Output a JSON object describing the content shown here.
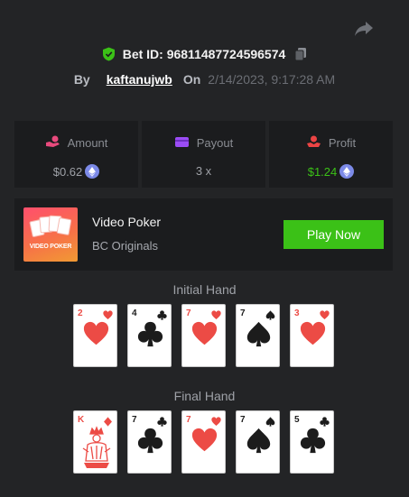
{
  "bet": {
    "id_label": "Bet ID: 96811487724596574",
    "by_label": "By",
    "username": "kaftanujwb",
    "on_label": "On",
    "date": "2/14/2023, 9:17:28 AM"
  },
  "stats": [
    {
      "label": "Amount",
      "value": "$0.62",
      "icon": "money-hand-icon",
      "color": "#e94a7d"
    },
    {
      "label": "Payout",
      "value": "3 x",
      "icon": "wallet-icon",
      "color": "#9b4cf5"
    },
    {
      "label": "Profit",
      "value": "$1.24",
      "icon": "profit-hand-icon",
      "color": "#ec4444",
      "value_color": "#3bc117"
    }
  ],
  "currency_icon": "ethereum-icon",
  "game": {
    "title": "Video Poker",
    "subtitle": "BC Originals",
    "thumb_text": "VIDEO POKER",
    "play_label": "Play Now"
  },
  "initial_hand": {
    "title": "Initial Hand",
    "cards": [
      {
        "rank": "2",
        "suit": "hearts"
      },
      {
        "rank": "4",
        "suit": "clubs"
      },
      {
        "rank": "7",
        "suit": "hearts"
      },
      {
        "rank": "7",
        "suit": "spades"
      },
      {
        "rank": "3",
        "suit": "hearts"
      }
    ]
  },
  "final_hand": {
    "title": "Final Hand",
    "cards": [
      {
        "rank": "K",
        "suit": "diamonds"
      },
      {
        "rank": "7",
        "suit": "clubs"
      },
      {
        "rank": "7",
        "suit": "hearts"
      },
      {
        "rank": "7",
        "suit": "spades"
      },
      {
        "rank": "5",
        "suit": "clubs"
      }
    ]
  }
}
